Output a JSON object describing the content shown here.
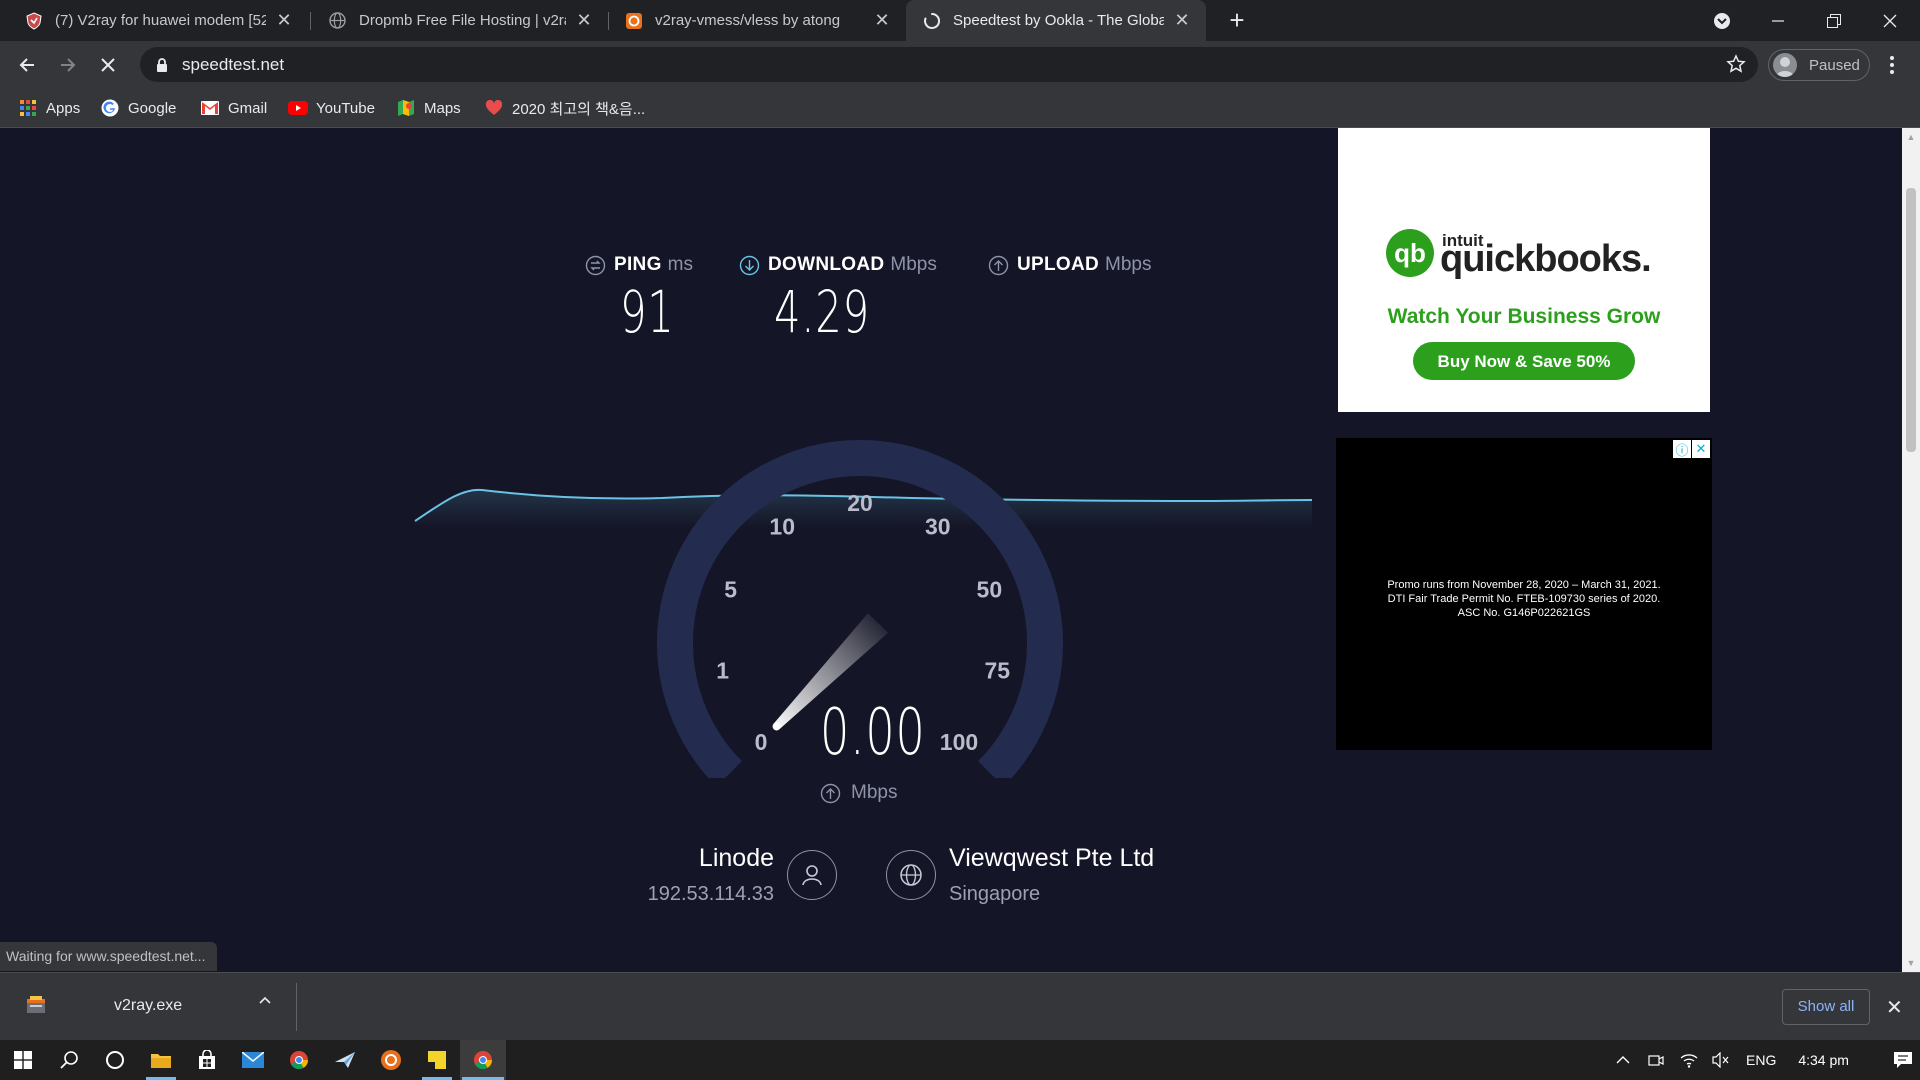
{
  "browser": {
    "tabs": [
      {
        "title": "(7) V2ray for huawei modem [52",
        "active": false
      },
      {
        "title": "Dropmb Free File Hosting | v2ray",
        "active": false
      },
      {
        "title": "v2ray-vmess/vless by atong",
        "active": false
      },
      {
        "title": "Speedtest by Ookla - The Global",
        "active": true
      }
    ],
    "url": "speedtest.net",
    "profile_label": "Paused",
    "bookmarks": [
      "Apps",
      "Google",
      "Gmail",
      "YouTube",
      "Maps",
      "2020 최고의 책&음..."
    ]
  },
  "speedtest": {
    "ping": {
      "label": "PING",
      "unit": "ms",
      "value": "91"
    },
    "download": {
      "label": "DOWNLOAD",
      "unit": "Mbps",
      "value": "4.29"
    },
    "upload": {
      "label": "UPLOAD",
      "unit": "Mbps"
    },
    "gauge": {
      "ticks": [
        "0",
        "1",
        "5",
        "10",
        "20",
        "30",
        "50",
        "75",
        "100"
      ],
      "current_value": "0.00",
      "unit": "Mbps",
      "needle_value": 0
    },
    "host": {
      "name": "Linode",
      "ip": "192.53.114.33"
    },
    "server": {
      "name": "Viewqwest Pte Ltd",
      "location": "Singapore"
    }
  },
  "ads": {
    "quickbooks": {
      "brand_small": "intuit",
      "brand": "quickbooks",
      "tagline": "Watch Your Business Grow",
      "cta": "Buy Now & Save 50%"
    },
    "promo": {
      "lines": [
        "Promo runs from November 28, 2020 – March 31, 2021.",
        "DTI Fair Trade Permit No. FTEB-109730 series of 2020.",
        "ASC No. G146P022621GS"
      ]
    }
  },
  "status_text": "Waiting for www.speedtest.net...",
  "downloads": {
    "file": "v2ray.exe",
    "show_all": "Show all"
  },
  "taskbar": {
    "lang": "ENG",
    "time": "4:34 pm"
  },
  "colors": {
    "gauge_track": "#232c4f",
    "graph_line": "#6ac3e6",
    "qb_green": "#2ca01c",
    "page_bg": "#141526"
  }
}
